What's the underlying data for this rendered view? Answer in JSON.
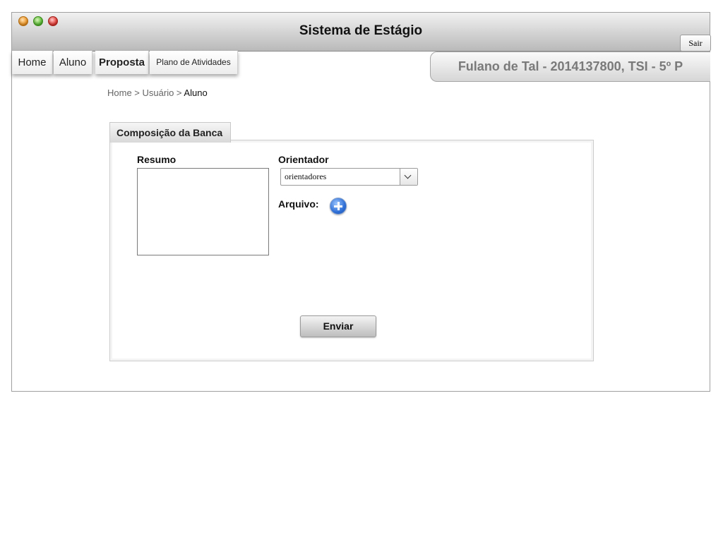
{
  "window": {
    "title": "Sistema de Estágio",
    "logout_label": "Sair"
  },
  "nav": {
    "items": [
      {
        "label": "Home"
      },
      {
        "label": "Aluno"
      },
      {
        "label": "Proposta"
      },
      {
        "label": "Plano de Atividades"
      }
    ]
  },
  "user": {
    "info": "Fulano de Tal - 2014137800, TSI - 5º P"
  },
  "breadcrumb": {
    "home": "Home",
    "sep1": " > ",
    "usuario": "Usuário",
    "sep2": " > ",
    "current": "Aluno"
  },
  "form": {
    "tab_label": "Composição da Banca",
    "resumo_label": "Resumo",
    "resumo_value": "",
    "orientador_label": "Orientador",
    "orientador_selected": "orientadores",
    "arquivo_label": "Arquivo:",
    "submit_label": "Enviar"
  },
  "icons": {
    "add_file": "plus-circle-icon",
    "dropdown": "chevron-down-icon"
  },
  "colors": {
    "accent_blue": "#2f6fd6",
    "user_text": "#7a7a7a"
  }
}
